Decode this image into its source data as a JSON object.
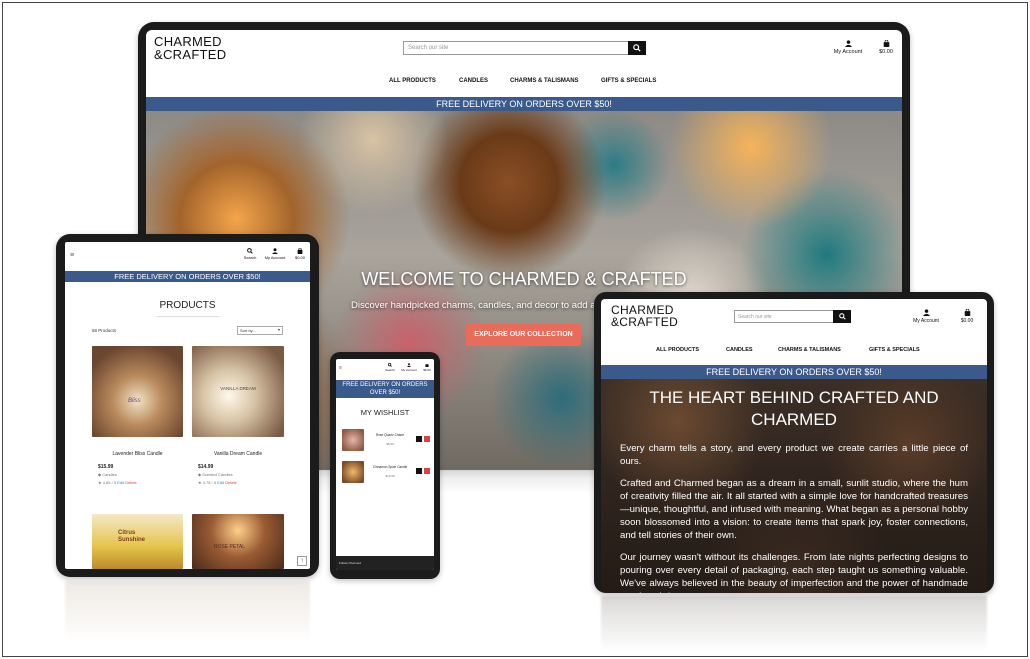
{
  "brand": {
    "line1": "CHARMED",
    "line2": "&CRAFTED"
  },
  "search": {
    "placeholder": "Search our site"
  },
  "account": {
    "my_account": "My Account",
    "cart_total": "$0.00",
    "search_label": "Search"
  },
  "nav": {
    "items": [
      "ALL PRODUCTS",
      "CANDLES",
      "CHARMS & TALISMANS",
      "GIFTS & SPECIALS"
    ]
  },
  "banner": {
    "text": "FREE DELIVERY ON ORDERS OVER $50!"
  },
  "hero": {
    "title": "WELCOME TO CHARMED & CRAFTED",
    "subtitle": "Discover handpicked charms, candles, and decor to add a tou",
    "cta": "EXPLORE OUR COLLECTION"
  },
  "tablet": {
    "heading": "PRODUCTS",
    "count": "58 Products",
    "sort": "Sort by...",
    "products": [
      {
        "name": "Lavender Bliss Candle",
        "price": "$15.99",
        "category": "Candles",
        "rating": "4.85 / 5",
        "edit": "Edit",
        "delete": "Delete",
        "img_label": "Bliss"
      },
      {
        "name": "Vanilla Dream Candle",
        "price": "$14.99",
        "category": "Scented Candles",
        "rating": "4.78 / 5",
        "edit": "Edit",
        "delete": "Delete",
        "img_label": "VANILLA DREAM"
      },
      {
        "name": "",
        "img_label": "Citrus Sunshine"
      },
      {
        "name": "",
        "img_label": "ROSE PETAL"
      }
    ]
  },
  "phone": {
    "heading": "MY WISHLIST",
    "items": [
      {
        "name": "Rose Quartz Charm",
        "price": "$8.99"
      },
      {
        "name": "Cinnamon Spice Candle",
        "price": "$13.99"
      }
    ],
    "footer": "Follow Charmed"
  },
  "about": {
    "title_line1": "THE HEART BEHIND CRAFTED AND",
    "title_line2": "CHARMED",
    "intro": "Every charm tells a story, and every product we create carries a little piece of ours.",
    "p1": "Crafted and Charmed began as a dream in a small, sunlit studio, where the hum of creativity filled the air. It all started with a simple love for handcrafted treasures—unique, thoughtful, and infused with meaning. What began as a personal hobby soon blossomed into a vision: to create items that spark joy, foster connections, and tell stories of their own.",
    "p2": "Our journey wasn't without its challenges. From late nights perfecting designs to pouring over every detail of packaging, each step taught us something valuable. We've always believed in the beauty of imperfection and the power of handmade goods to bring"
  },
  "colors": {
    "banner": "#3b5a8c",
    "cta": "#e96b5a",
    "device": "#1b1b1b"
  },
  "icons": {
    "search": "search-icon",
    "user": "user-icon",
    "cart": "cart-icon",
    "menu": "hamburger-icon",
    "star": "star-icon"
  }
}
